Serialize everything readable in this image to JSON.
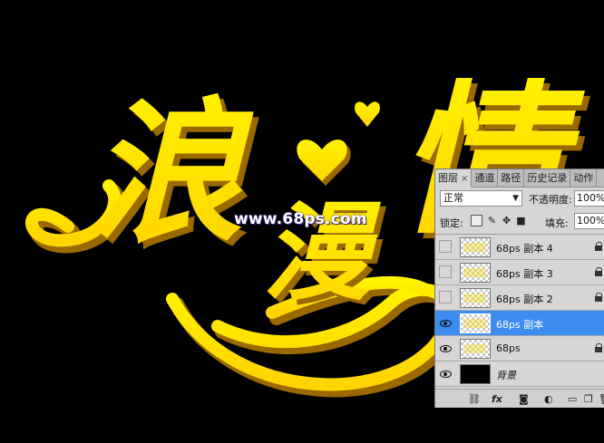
{
  "canvas": {
    "artwork_chars": [
      "浪",
      "漫",
      "情"
    ],
    "artwork_color": "#ffe600",
    "shadow_color": "#b07a00",
    "background": "#000000",
    "watermark": "www.68ps.com"
  },
  "layers_panel": {
    "tabs": [
      {
        "label": "图层",
        "active": true,
        "close": "×"
      },
      {
        "label": "通道",
        "active": false
      },
      {
        "label": "路径",
        "active": false
      },
      {
        "label": "历史记录",
        "active": false
      },
      {
        "label": "动作",
        "active": false
      }
    ],
    "blend_mode": "正常",
    "opacity_label": "不透明度:",
    "opacity_value": "100%",
    "lock_label": "锁定:",
    "fill_label": "填充:",
    "fill_value": "100%",
    "layers": [
      {
        "name": "68ps 副本 4",
        "visible": false,
        "selected": false,
        "locked": true,
        "thumb": "transparent"
      },
      {
        "name": "68ps 副本 3",
        "visible": false,
        "selected": false,
        "locked": true,
        "thumb": "transparent"
      },
      {
        "name": "68ps 副本 2",
        "visible": false,
        "selected": false,
        "locked": true,
        "thumb": "transparent"
      },
      {
        "name": "68ps 副本",
        "visible": true,
        "selected": true,
        "locked": false,
        "thumb": "transparent"
      },
      {
        "name": "68ps",
        "visible": true,
        "selected": false,
        "locked": true,
        "thumb": "transparent"
      },
      {
        "name": "背景",
        "visible": true,
        "selected": false,
        "locked": false,
        "thumb": "black",
        "italic": true
      }
    ],
    "footer_icons": [
      "link-icon",
      "fx-icon",
      "mask-icon",
      "adjustment-icon",
      "group-folder-icon",
      "new-layer-icon",
      "delete-icon"
    ],
    "footer_fx_label": "fx"
  }
}
